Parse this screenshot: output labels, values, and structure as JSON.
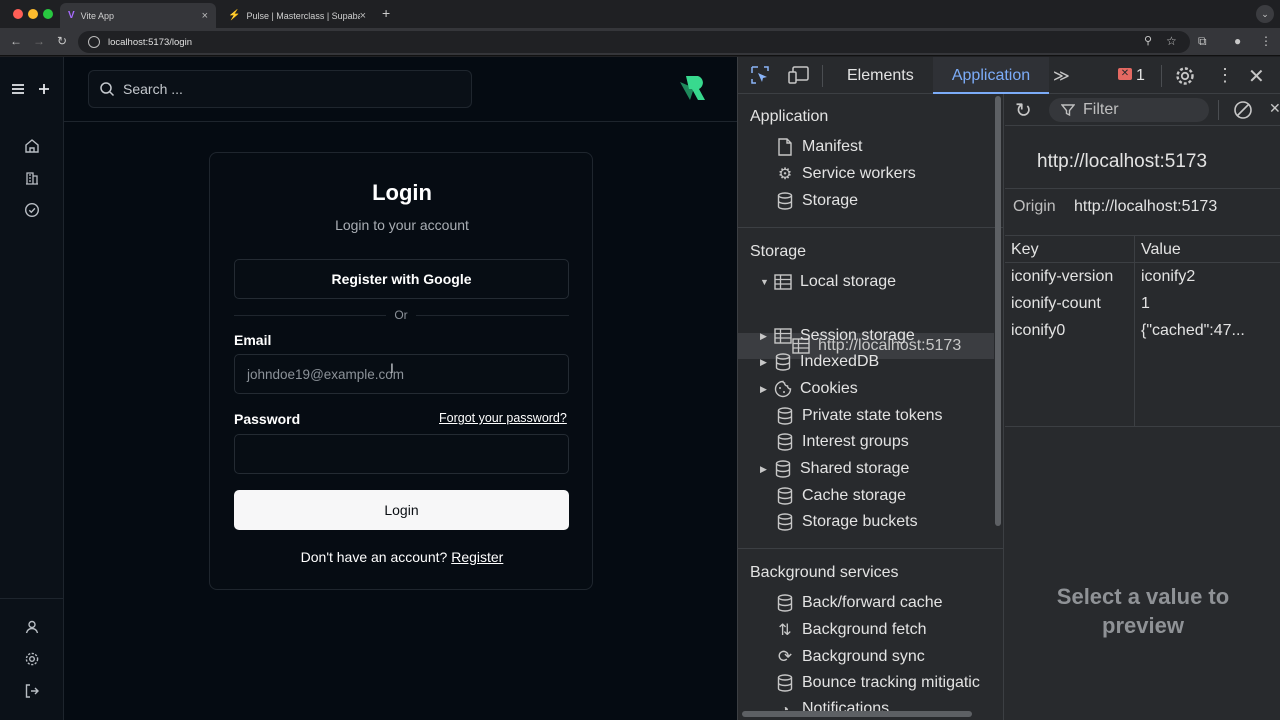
{
  "browser": {
    "tabs": [
      {
        "title": "Vite App",
        "active": true
      },
      {
        "title": "Pulse | Masterclass | Supaba",
        "active": false
      }
    ],
    "new_tab": "+",
    "url": "localhost:5173/login"
  },
  "app": {
    "search_placeholder": "Search ...",
    "login": {
      "title": "Login",
      "subtitle": "Login to your account",
      "google_button": "Register with Google",
      "divider": "Or",
      "email_label": "Email",
      "email_placeholder": "johndoe19@example.com",
      "password_label": "Password",
      "forgot_link": "Forgot your password?",
      "login_button": "Login",
      "no_account": "Don't have an account?",
      "register_link": "Register"
    }
  },
  "devtools": {
    "tabs": [
      "Elements",
      "Application"
    ],
    "active_tab": "Application",
    "error_count": "1",
    "sidebar": {
      "application_title": "Application",
      "application_items": [
        "Manifest",
        "Service workers",
        "Storage"
      ],
      "storage_title": "Storage",
      "local_storage": "Local storage",
      "local_storage_origin": "http://localhost:5173",
      "storage_items": [
        "Session storage",
        "IndexedDB",
        "Cookies",
        "Private state tokens",
        "Interest groups",
        "Shared storage",
        "Cache storage",
        "Storage buckets"
      ],
      "background_title": "Background services",
      "background_items": [
        "Back/forward cache",
        "Background fetch",
        "Background sync",
        "Bounce tracking mitigatic",
        "Notifications"
      ]
    },
    "panel": {
      "filter_placeholder": "Filter",
      "origin_heading": "http://localhost:5173",
      "origin_label": "Origin",
      "origin_value": "http://localhost:5173",
      "columns": [
        "Key",
        "Value"
      ],
      "rows": [
        {
          "key": "iconify-version",
          "value": "iconify2"
        },
        {
          "key": "iconify-count",
          "value": "1"
        },
        {
          "key": "iconify0",
          "value": "{\"cached\":47..."
        }
      ],
      "preview_text": "Select a value to preview"
    }
  }
}
